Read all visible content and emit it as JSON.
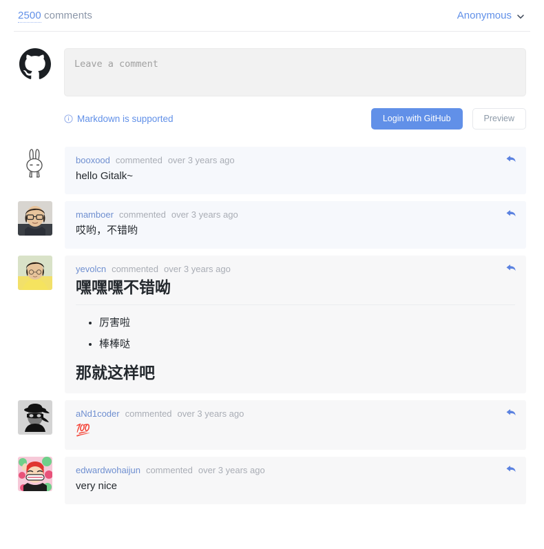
{
  "header": {
    "count": "2500",
    "count_suffix": " comments",
    "user_label": "Anonymous",
    "chevron_icon": "chevron-down-icon"
  },
  "editor": {
    "avatar_icon": "github-octocat-icon",
    "placeholder": "Leave a comment",
    "value": "",
    "markdown_tip": "Markdown is supported",
    "info_icon": "info-circle-icon",
    "login_button": "Login with GitHub",
    "preview_button": "Preview",
    "accent_color": "#6190e8"
  },
  "comments": [
    {
      "username": "booxood",
      "action": "commented",
      "date": "over 3 years ago",
      "avatar": "rabbit-avatar",
      "body_text": "hello Gitalk~",
      "reply_icon": "reply-arrow-icon"
    },
    {
      "username": "mamboer",
      "action": "commented",
      "date": "over 3 years ago",
      "avatar": "man-glasses-avatar",
      "body_text": "哎哟，不错哟",
      "reply_icon": "reply-arrow-icon"
    },
    {
      "username": "yevolcn",
      "action": "commented",
      "date": "over 3 years ago",
      "avatar": "man-yellow-shirt-avatar",
      "heading": "嘿嘿嘿不错呦",
      "list_items": [
        "厉害啦",
        "棒棒哒"
      ],
      "heading2": "那就这样吧",
      "reply_icon": "reply-arrow-icon"
    },
    {
      "username": "aNd1coder",
      "action": "commented",
      "date": "over 3 years ago",
      "avatar": "spy-silhouette-avatar",
      "body_text": "💯",
      "reply_icon": "reply-arrow-icon"
    },
    {
      "username": "edwardwohaijun",
      "action": "commented",
      "date": "over 3 years ago",
      "avatar": "cartoon-redhair-avatar",
      "body_text": "very nice",
      "reply_icon": "reply-arrow-icon"
    }
  ]
}
